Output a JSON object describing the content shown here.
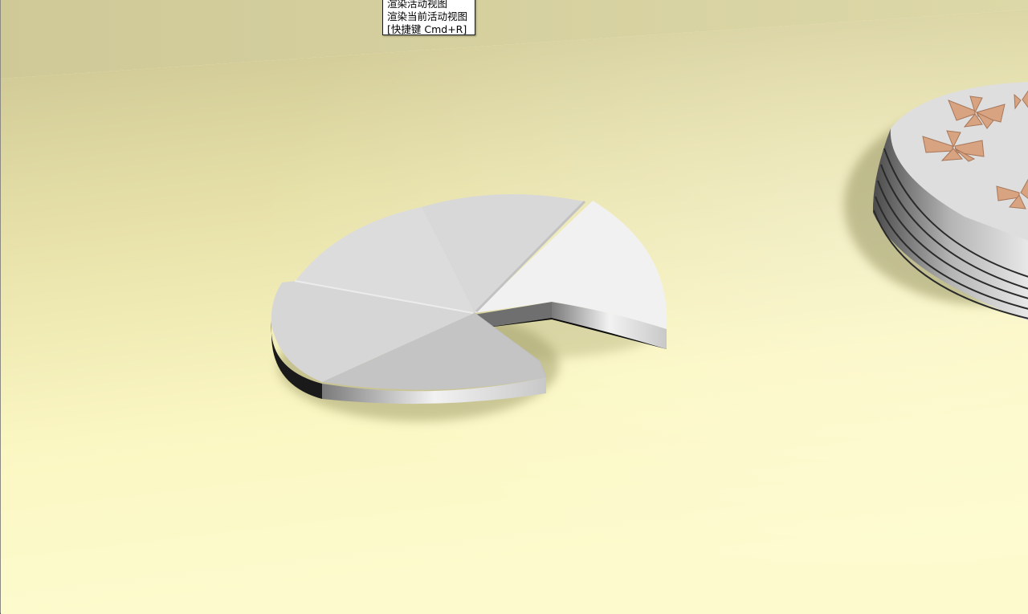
{
  "tooltip": {
    "title": "渲染活动视图",
    "description": "渲染当前活动视图",
    "shortcut": "[快捷键 Cmd+R]"
  }
}
